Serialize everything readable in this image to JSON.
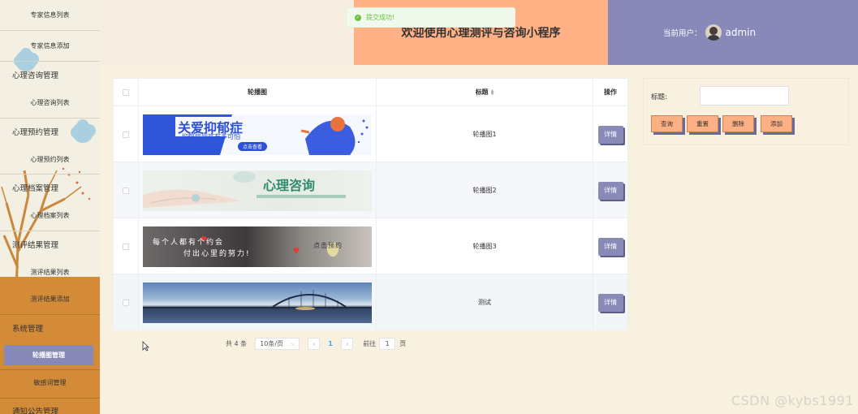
{
  "sidebar": {
    "items": [
      {
        "label": "专家信息列表",
        "type": "sub"
      },
      {
        "label": "专家信息添加",
        "type": "sub"
      },
      {
        "label": "心理咨询管理",
        "type": "group"
      },
      {
        "label": "心理咨询列表",
        "type": "sub"
      },
      {
        "label": "心理预约管理",
        "type": "group"
      },
      {
        "label": "心理预约列表",
        "type": "sub"
      },
      {
        "label": "心理档案管理",
        "type": "group"
      },
      {
        "label": "心理档案列表",
        "type": "sub"
      },
      {
        "label": "测评结果管理",
        "type": "group"
      },
      {
        "label": "测评结果列表",
        "type": "sub"
      },
      {
        "label": "测评结果添加",
        "type": "sub"
      },
      {
        "label": "系统管理",
        "type": "group"
      },
      {
        "label": "轮播图管理",
        "type": "active"
      },
      {
        "label": "敏感词管理",
        "type": "sub"
      },
      {
        "label": "通知公告管理",
        "type": "group"
      }
    ]
  },
  "header": {
    "title": "欢迎使用心理测评与咨询小程序",
    "user_label": "当前用户：",
    "username": "admin"
  },
  "toast": {
    "text": "提交成功!",
    "color": "#67c23a"
  },
  "table": {
    "columns": [
      "轮播图",
      "标题",
      "操作"
    ],
    "rows": [
      {
        "title": "轮播图1",
        "action": "详情",
        "banner": {
          "line1": "关爱抑郁症",
          "line2": "抑郁症到底有多可怕",
          "button": "点击查看"
        }
      },
      {
        "title": "轮播图2",
        "action": "详情",
        "banner": {
          "line1": "心理咨询"
        }
      },
      {
        "title": "轮播图3",
        "action": "详情",
        "banner": {
          "line1": "每个人都有个约会",
          "line2": "付出心里的努力!",
          "tag": "点击预约"
        }
      },
      {
        "title": "测试",
        "action": "详情",
        "banner": {}
      }
    ]
  },
  "pagination": {
    "total": "共 4 条",
    "page_size": "10条/页",
    "current": "1",
    "goto_label": "前往",
    "goto_value": "1",
    "page_suffix": "页"
  },
  "search": {
    "label": "标题:",
    "value": "",
    "buttons": [
      "查询",
      "重置",
      "删除",
      "添加"
    ]
  },
  "watermark": "CSDN @kybs1991",
  "colors": {
    "accent_purple": "#8888b9",
    "accent_orange": "#ffb185",
    "sidebar_orange": "#d48b38",
    "background": "#f8f1e0"
  }
}
